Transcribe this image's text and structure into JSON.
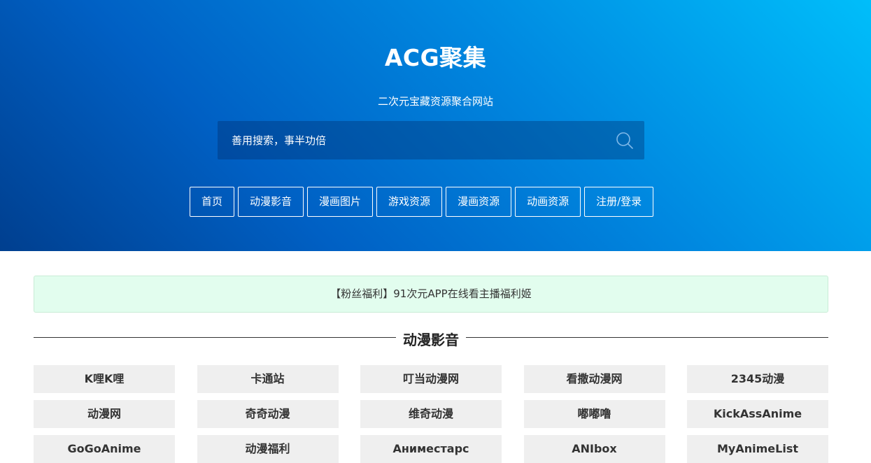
{
  "header": {
    "title": "ACG聚集",
    "subtitle": "二次元宝藏资源聚合网站"
  },
  "search": {
    "placeholder": "善用搜索，事半功倍",
    "icon": "search-icon"
  },
  "nav": {
    "items": [
      "首页",
      "动漫影音",
      "漫画图片",
      "游戏资源",
      "漫画资源",
      "动画资源",
      "注册/登录"
    ]
  },
  "notice": {
    "text": "【粉丝福利】91次元APP在线看主播福利姬"
  },
  "section": {
    "title": "动漫影音",
    "items": [
      "K哩K哩",
      "卡通站",
      "叮当动漫网",
      "看撒动漫网",
      "2345动漫",
      "动漫网",
      "奇奇动漫",
      "维奇动漫",
      "嘟嘟噜",
      "KickAssAnime",
      "GoGoAnime",
      "动漫福利",
      "Аниместарс",
      "ANIbox",
      "MyAnimeList"
    ]
  },
  "colors": {
    "hero_start": "#003f8f",
    "hero_end": "#00befa",
    "notice_bg": "#e2fdee",
    "tile_bg": "#efefef"
  }
}
